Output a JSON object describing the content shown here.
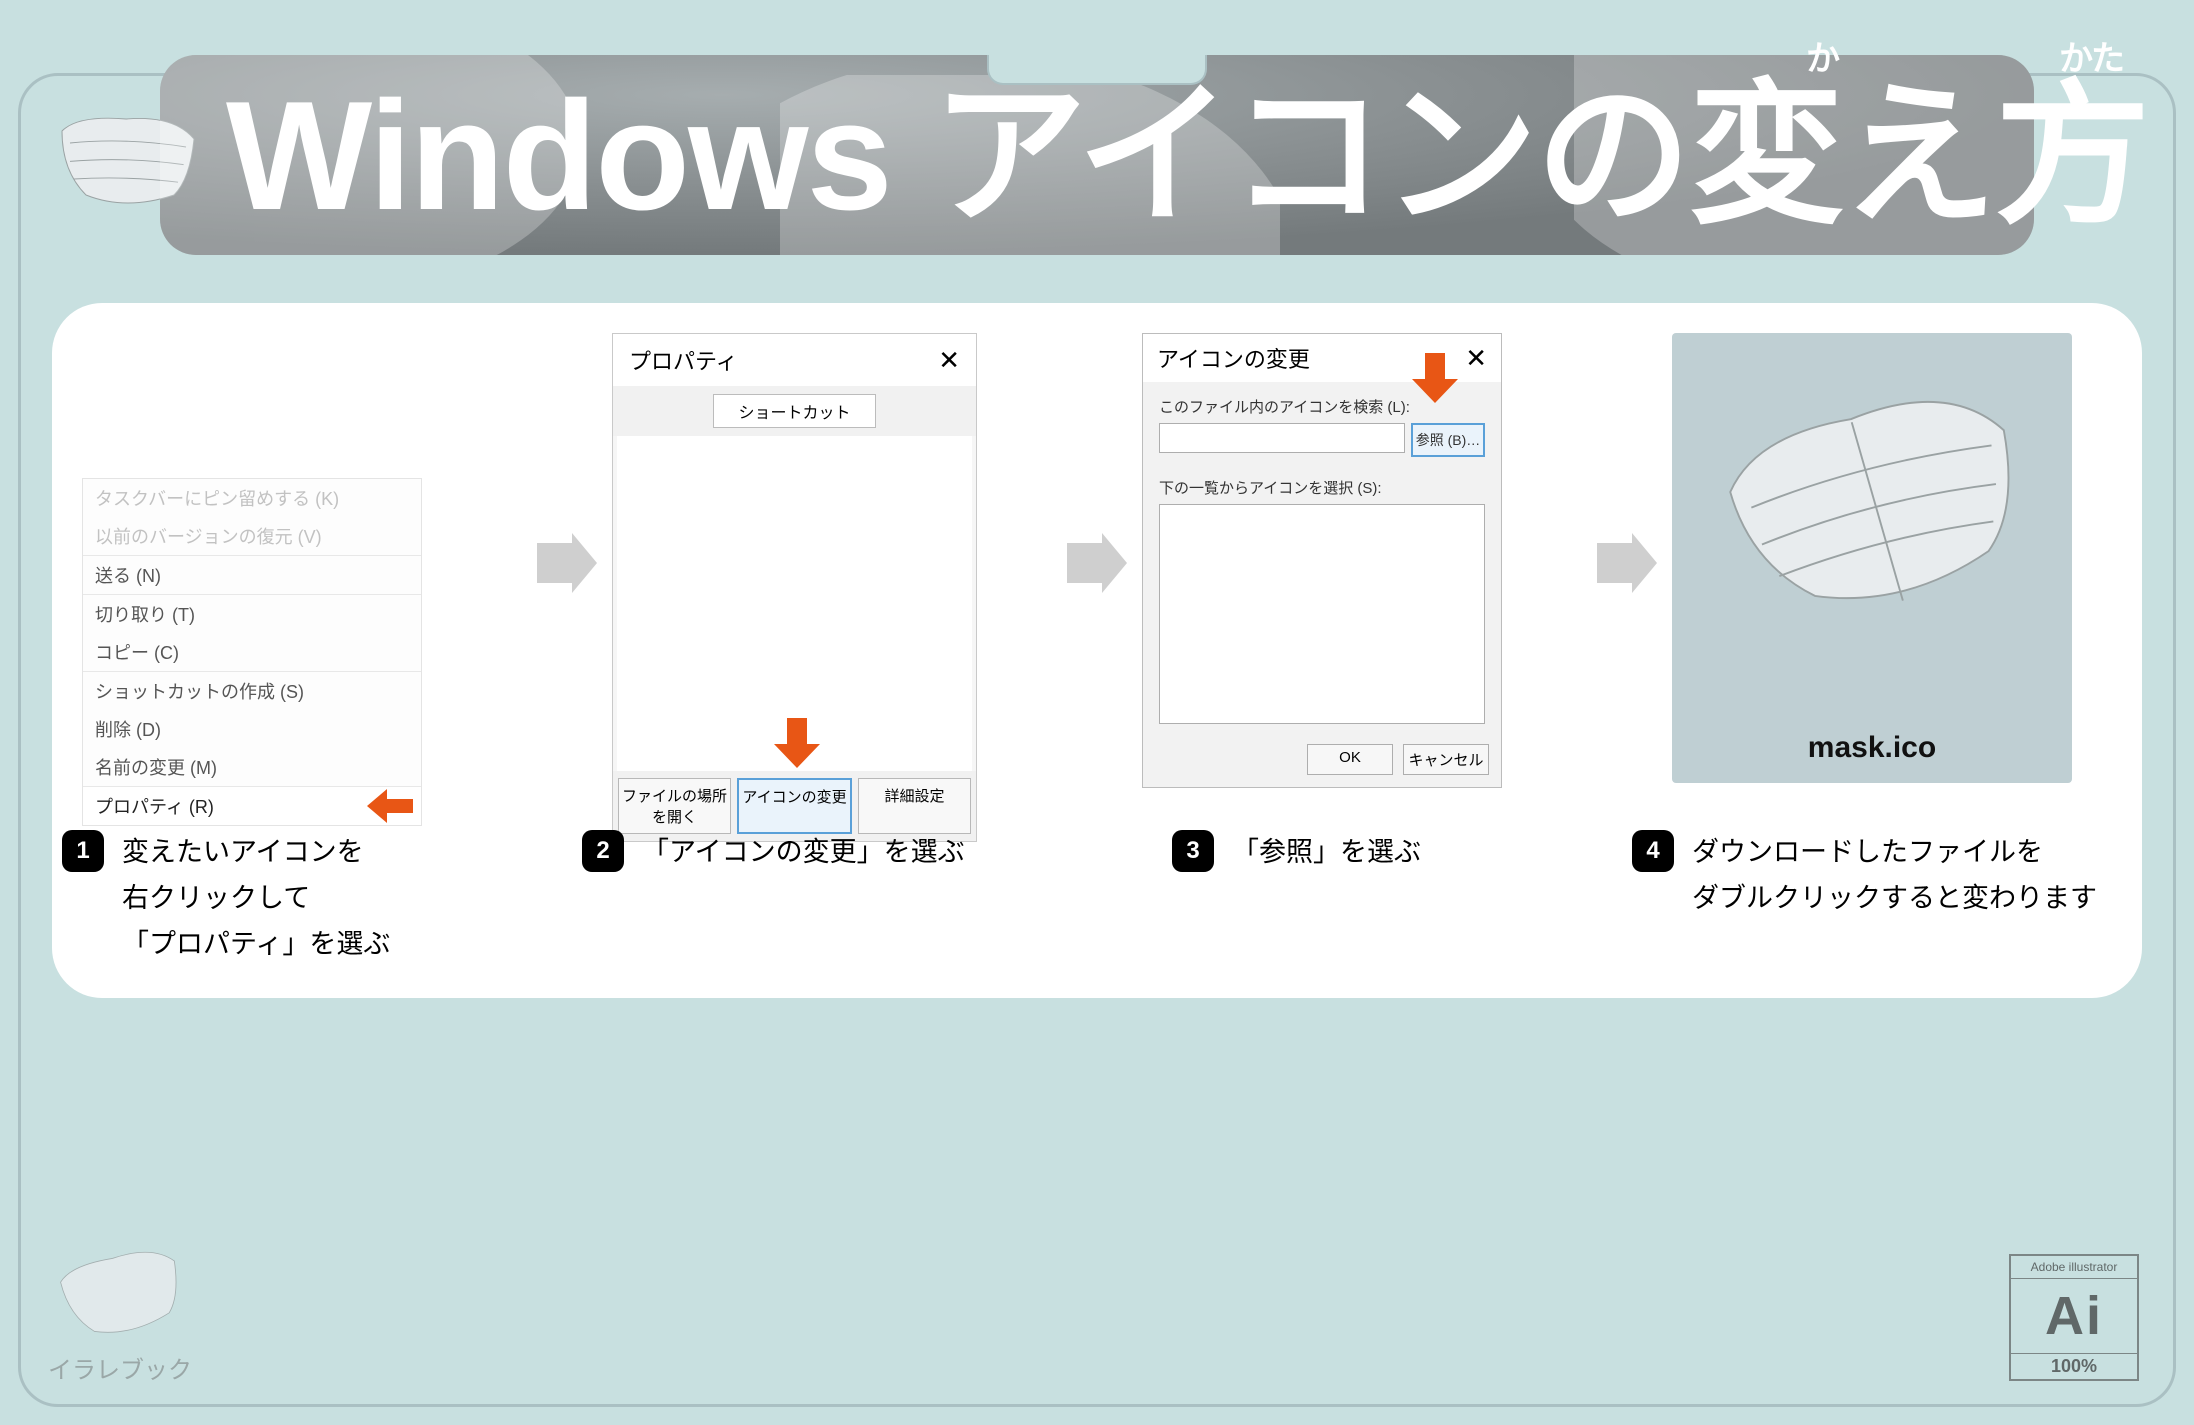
{
  "hero": {
    "title": "Windows アイコンの変え方",
    "ruby_ka": "か",
    "ruby_kata": "かた"
  },
  "steps": {
    "s1": {
      "num": "1",
      "caption_l1": "変えたいアイコンを",
      "caption_l2": "右クリックして",
      "caption_l3": "「プロパティ」を選ぶ",
      "menu": {
        "faded1": "タスクバーにピン留めする (K)",
        "faded2": "以前のバージョンの復元 (V)",
        "send": "送る (N)",
        "cut": "切り取り (T)",
        "copy": "コピー (C)",
        "shortcut": "ショットカットの作成 (S)",
        "delete": "削除 (D)",
        "rename": "名前の変更 (M)",
        "properties": "プロパティ (R)"
      }
    },
    "s2": {
      "num": "2",
      "caption": "「アイコンの変更」を選ぶ",
      "win": {
        "title": "プロパティ",
        "tab": "ショートカット",
        "btn_open": "ファイルの場所を開く",
        "btn_change": "アイコンの変更",
        "btn_adv": "詳細設定"
      }
    },
    "s3": {
      "num": "3",
      "caption": "「参照」を選ぶ",
      "win": {
        "title": "アイコンの変更",
        "search_label": "このファイル内のアイコンを検索 (L):",
        "browse": "参照 (B)…",
        "list_label": "下の一覧からアイコンを選択 (S):",
        "ok": "OK",
        "cancel": "キャンセル"
      }
    },
    "s4": {
      "num": "4",
      "caption_l1": "ダウンロードしたファイルを",
      "caption_l2": "ダブルクリックすると変わります",
      "filename": "mask.ico"
    }
  },
  "footer": {
    "brand": "イラレブック",
    "ai_top": "Adobe illustrator",
    "ai_mid": "Ai",
    "ai_bot": "100%"
  }
}
